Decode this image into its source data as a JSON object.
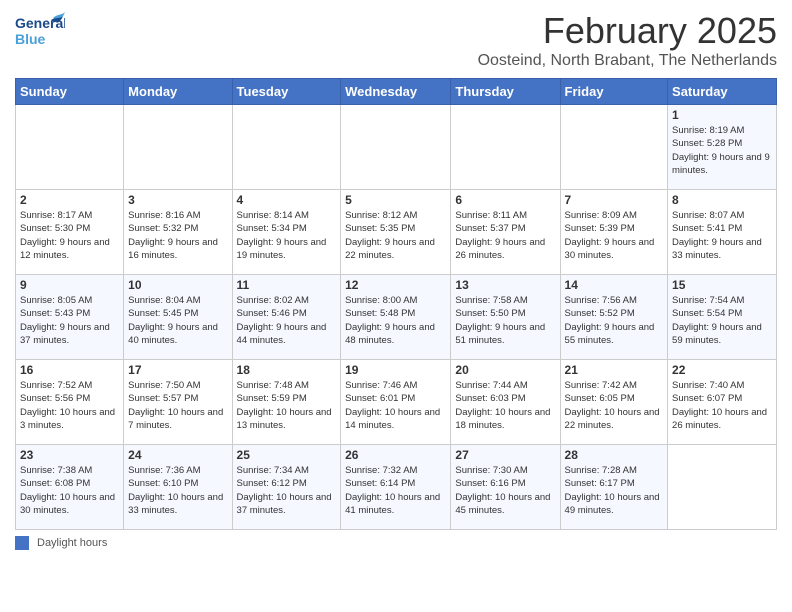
{
  "header": {
    "logo_line1": "General",
    "logo_line2": "Blue",
    "title": "February 2025",
    "subtitle": "Oosteind, North Brabant, The Netherlands"
  },
  "days_of_week": [
    "Sunday",
    "Monday",
    "Tuesday",
    "Wednesday",
    "Thursday",
    "Friday",
    "Saturday"
  ],
  "weeks": [
    [
      {
        "day": "",
        "info": ""
      },
      {
        "day": "",
        "info": ""
      },
      {
        "day": "",
        "info": ""
      },
      {
        "day": "",
        "info": ""
      },
      {
        "day": "",
        "info": ""
      },
      {
        "day": "",
        "info": ""
      },
      {
        "day": "1",
        "info": "Sunrise: 8:19 AM\nSunset: 5:28 PM\nDaylight: 9 hours and 9 minutes."
      }
    ],
    [
      {
        "day": "2",
        "info": "Sunrise: 8:17 AM\nSunset: 5:30 PM\nDaylight: 9 hours and 12 minutes."
      },
      {
        "day": "3",
        "info": "Sunrise: 8:16 AM\nSunset: 5:32 PM\nDaylight: 9 hours and 16 minutes."
      },
      {
        "day": "4",
        "info": "Sunrise: 8:14 AM\nSunset: 5:34 PM\nDaylight: 9 hours and 19 minutes."
      },
      {
        "day": "5",
        "info": "Sunrise: 8:12 AM\nSunset: 5:35 PM\nDaylight: 9 hours and 22 minutes."
      },
      {
        "day": "6",
        "info": "Sunrise: 8:11 AM\nSunset: 5:37 PM\nDaylight: 9 hours and 26 minutes."
      },
      {
        "day": "7",
        "info": "Sunrise: 8:09 AM\nSunset: 5:39 PM\nDaylight: 9 hours and 30 minutes."
      },
      {
        "day": "8",
        "info": "Sunrise: 8:07 AM\nSunset: 5:41 PM\nDaylight: 9 hours and 33 minutes."
      }
    ],
    [
      {
        "day": "9",
        "info": "Sunrise: 8:05 AM\nSunset: 5:43 PM\nDaylight: 9 hours and 37 minutes."
      },
      {
        "day": "10",
        "info": "Sunrise: 8:04 AM\nSunset: 5:45 PM\nDaylight: 9 hours and 40 minutes."
      },
      {
        "day": "11",
        "info": "Sunrise: 8:02 AM\nSunset: 5:46 PM\nDaylight: 9 hours and 44 minutes."
      },
      {
        "day": "12",
        "info": "Sunrise: 8:00 AM\nSunset: 5:48 PM\nDaylight: 9 hours and 48 minutes."
      },
      {
        "day": "13",
        "info": "Sunrise: 7:58 AM\nSunset: 5:50 PM\nDaylight: 9 hours and 51 minutes."
      },
      {
        "day": "14",
        "info": "Sunrise: 7:56 AM\nSunset: 5:52 PM\nDaylight: 9 hours and 55 minutes."
      },
      {
        "day": "15",
        "info": "Sunrise: 7:54 AM\nSunset: 5:54 PM\nDaylight: 9 hours and 59 minutes."
      }
    ],
    [
      {
        "day": "16",
        "info": "Sunrise: 7:52 AM\nSunset: 5:56 PM\nDaylight: 10 hours and 3 minutes."
      },
      {
        "day": "17",
        "info": "Sunrise: 7:50 AM\nSunset: 5:57 PM\nDaylight: 10 hours and 7 minutes."
      },
      {
        "day": "18",
        "info": "Sunrise: 7:48 AM\nSunset: 5:59 PM\nDaylight: 10 hours and 13 minutes."
      },
      {
        "day": "19",
        "info": "Sunrise: 7:46 AM\nSunset: 6:01 PM\nDaylight: 10 hours and 14 minutes."
      },
      {
        "day": "20",
        "info": "Sunrise: 7:44 AM\nSunset: 6:03 PM\nDaylight: 10 hours and 18 minutes."
      },
      {
        "day": "21",
        "info": "Sunrise: 7:42 AM\nSunset: 6:05 PM\nDaylight: 10 hours and 22 minutes."
      },
      {
        "day": "22",
        "info": "Sunrise: 7:40 AM\nSunset: 6:07 PM\nDaylight: 10 hours and 26 minutes."
      }
    ],
    [
      {
        "day": "23",
        "info": "Sunrise: 7:38 AM\nSunset: 6:08 PM\nDaylight: 10 hours and 30 minutes."
      },
      {
        "day": "24",
        "info": "Sunrise: 7:36 AM\nSunset: 6:10 PM\nDaylight: 10 hours and 33 minutes."
      },
      {
        "day": "25",
        "info": "Sunrise: 7:34 AM\nSunset: 6:12 PM\nDaylight: 10 hours and 37 minutes."
      },
      {
        "day": "26",
        "info": "Sunrise: 7:32 AM\nSunset: 6:14 PM\nDaylight: 10 hours and 41 minutes."
      },
      {
        "day": "27",
        "info": "Sunrise: 7:30 AM\nSunset: 6:16 PM\nDaylight: 10 hours and 45 minutes."
      },
      {
        "day": "28",
        "info": "Sunrise: 7:28 AM\nSunset: 6:17 PM\nDaylight: 10 hours and 49 minutes."
      },
      {
        "day": "",
        "info": ""
      }
    ]
  ],
  "legend": {
    "box_label": "Daylight hours"
  },
  "accent_color": "#4472c4"
}
